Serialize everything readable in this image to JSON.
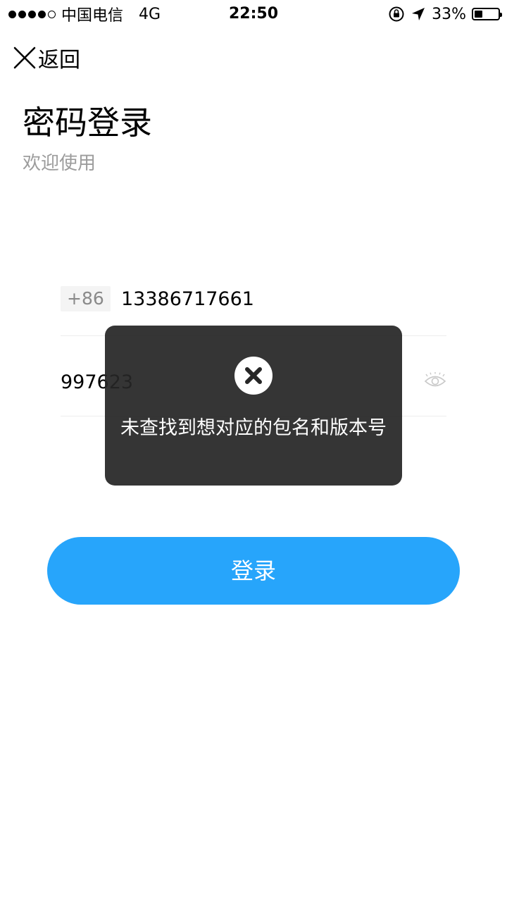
{
  "status_bar": {
    "carrier": "中国电信",
    "network": "4G",
    "time": "22:50",
    "battery": "33%",
    "battery_level": 0.33,
    "signal_bars": 4,
    "signal_total": 5
  },
  "nav": {
    "back_label": "返回"
  },
  "header": {
    "title": "密码登录",
    "subtitle": "欢迎使用"
  },
  "form": {
    "country_code": "+86",
    "phone": "13386717661",
    "password": "997623"
  },
  "login_button": "登录",
  "toast": {
    "message": "未查找到想对应的包名和版本号"
  },
  "colors": {
    "primary": "#27a5fb",
    "toast_bg": "#262626",
    "muted": "#9c9c9c"
  },
  "icons": {
    "back": "close-icon",
    "eye": "eye-icon",
    "toast": "error-icon",
    "location": "location-arrow-icon",
    "rotation": "rotation-lock-icon"
  }
}
